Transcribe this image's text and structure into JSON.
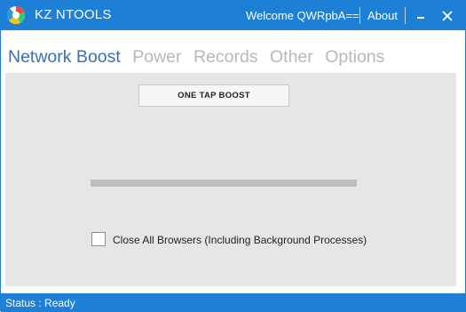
{
  "titlebar": {
    "app_title": "KZ NTOOLS",
    "welcome": "Welcome QWRpbA==",
    "about": "About",
    "logo_icon": "app-logo-icon",
    "minimize_icon": "minimize-icon",
    "close_icon": "close-icon"
  },
  "tabs": [
    {
      "label": "Network Boost",
      "active": true
    },
    {
      "label": "Power",
      "active": false
    },
    {
      "label": "Records",
      "active": false
    },
    {
      "label": "Other",
      "active": false
    },
    {
      "label": "Options",
      "active": false
    }
  ],
  "main": {
    "boost_button": "ONE TAP BOOST",
    "progress": 1.0,
    "close_browsers_label": "Close All Browsers (Including Background Processes)",
    "close_browsers_checked": false
  },
  "status": {
    "text": "Status : Ready"
  },
  "colors": {
    "accent": "#1e7fd6",
    "active_tab": "#3a6fb5",
    "inactive_tab": "#b8b8b8",
    "panel": "#e6e6e6"
  }
}
